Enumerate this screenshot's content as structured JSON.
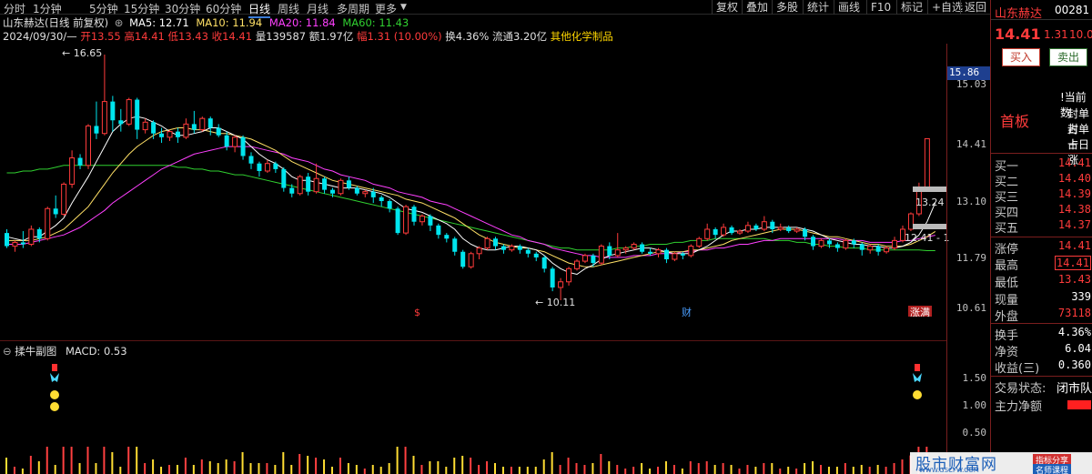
{
  "toolbar": {
    "timeframes": [
      "分时",
      "1分钟",
      "5分钟",
      "15分钟",
      "30分钟",
      "60分钟",
      "日线",
      "周线",
      "月线",
      "多周期",
      "更多"
    ],
    "active_timeframe": "日线",
    "right_buttons": [
      "复权",
      "叠加",
      "多股",
      "统计",
      "画线",
      "F10",
      "标记",
      "+自选",
      "返回"
    ]
  },
  "header": {
    "stock_title": "山东赫达(日线 前复权)",
    "ma5_label": "MA5: 12.71",
    "ma10_label": "MA10: 11.94",
    "ma20_label": "MA20: 11.84",
    "ma60_label": "MA60: 11.43",
    "date_line": "2024/09/30/—",
    "open": "开13.55",
    "high": "高14.41",
    "low": "低13.43",
    "close": "收14.41",
    "volume": "量139587",
    "amount": "额1.97亿",
    "change": "幅1.31 (10.00%)",
    "turnover": "换4.36%",
    "float_cap": "流通3.20亿",
    "industry": "其他化学制品"
  },
  "colors": {
    "up": "#ff3b3b",
    "down": "#00e5ee",
    "ma5": "#ffffff",
    "ma10": "#ffe066",
    "ma20": "#ff40ff",
    "ma60": "#30d030",
    "axis": "#7a1e1e",
    "label_yellow": "#ffd700"
  },
  "chart_data": {
    "type": "candlestick",
    "axis_labels": [
      "15.86",
      "15.03",
      "14.41",
      "13.10",
      "11.79",
      "10.61"
    ],
    "annotations": {
      "high_mark": "16.65",
      "low_mark": "10.11",
      "level_a": "13.24",
      "level_b": "12.41 - 1",
      "price_tag": "15.86",
      "tag_s": "$",
      "tag_cai": "财",
      "tag_zhangting": "涨满"
    },
    "candles": [
      [
        11.9,
        11.55,
        12.0,
        11.5
      ],
      [
        11.55,
        11.65,
        11.7,
        11.4
      ],
      [
        11.65,
        11.6,
        11.95,
        11.5
      ],
      [
        11.6,
        12.0,
        12.1,
        11.55
      ],
      [
        12.0,
        11.75,
        12.05,
        11.65
      ],
      [
        11.75,
        12.55,
        12.6,
        11.7
      ],
      [
        12.55,
        12.4,
        12.9,
        12.3
      ],
      [
        12.4,
        13.2,
        13.25,
        12.35
      ],
      [
        13.2,
        13.9,
        14.1,
        13.1
      ],
      [
        13.9,
        13.7,
        14.0,
        13.6
      ],
      [
        13.7,
        14.75,
        14.8,
        13.6
      ],
      [
        14.75,
        14.55,
        15.4,
        14.4
      ],
      [
        14.55,
        15.4,
        16.65,
        14.5
      ],
      [
        15.4,
        14.9,
        15.55,
        14.6
      ],
      [
        14.9,
        14.8,
        15.2,
        14.6
      ],
      [
        14.8,
        15.45,
        15.5,
        14.75
      ],
      [
        15.45,
        14.65,
        15.5,
        14.4
      ],
      [
        14.65,
        14.85,
        14.95,
        14.55
      ],
      [
        14.85,
        14.55,
        14.9,
        14.4
      ],
      [
        14.55,
        14.45,
        14.7,
        14.3
      ],
      [
        14.45,
        14.6,
        14.65,
        14.35
      ],
      [
        14.6,
        14.45,
        14.7,
        14.3
      ],
      [
        14.45,
        14.8,
        14.95,
        14.4
      ],
      [
        14.8,
        14.65,
        15.15,
        14.55
      ],
      [
        14.65,
        14.95,
        15.0,
        14.6
      ],
      [
        14.95,
        14.7,
        15.0,
        14.5
      ],
      [
        14.7,
        14.5,
        14.8,
        14.45
      ],
      [
        14.5,
        14.2,
        14.6,
        14.1
      ],
      [
        14.2,
        14.45,
        14.5,
        14.05
      ],
      [
        14.45,
        13.95,
        14.5,
        13.85
      ],
      [
        13.95,
        13.75,
        14.05,
        13.6
      ],
      [
        13.75,
        13.55,
        13.8,
        13.4
      ],
      [
        13.55,
        13.75,
        13.85,
        13.5
      ],
      [
        13.75,
        13.6,
        13.8,
        13.5
      ],
      [
        13.6,
        13.1,
        13.65,
        13.0
      ],
      [
        13.1,
        12.95,
        13.2,
        12.85
      ],
      [
        12.95,
        13.4,
        13.45,
        12.9
      ],
      [
        13.4,
        13.0,
        13.5,
        12.9
      ],
      [
        13.0,
        13.35,
        13.75,
        12.95
      ],
      [
        13.35,
        13.05,
        13.4,
        12.95
      ],
      [
        13.05,
        12.95,
        13.1,
        12.85
      ],
      [
        12.95,
        13.3,
        13.35,
        12.9
      ],
      [
        13.3,
        13.1,
        13.4,
        13.05
      ],
      [
        13.1,
        12.95,
        13.15,
        12.9
      ],
      [
        12.95,
        13.0,
        13.05,
        12.85
      ],
      [
        13.0,
        12.85,
        13.1,
        12.7
      ],
      [
        12.85,
        12.75,
        12.9,
        12.6
      ],
      [
        12.75,
        12.55,
        12.8,
        12.45
      ],
      [
        12.55,
        11.9,
        12.6,
        11.85
      ],
      [
        11.9,
        12.6,
        12.65,
        11.85
      ],
      [
        12.6,
        12.2,
        12.65,
        12.1
      ],
      [
        12.2,
        12.35,
        12.4,
        12.1
      ],
      [
        12.35,
        12.1,
        12.4,
        11.95
      ],
      [
        12.1,
        11.85,
        12.15,
        11.75
      ],
      [
        11.85,
        11.75,
        11.9,
        11.65
      ],
      [
        11.75,
        11.4,
        11.8,
        11.3
      ],
      [
        11.4,
        11.0,
        11.45,
        10.95
      ],
      [
        11.0,
        11.35,
        11.4,
        10.95
      ],
      [
        11.35,
        11.5,
        11.55,
        11.2
      ],
      [
        11.5,
        11.75,
        11.8,
        11.45
      ],
      [
        11.75,
        11.55,
        11.8,
        11.45
      ],
      [
        11.55,
        11.45,
        11.6,
        11.35
      ],
      [
        11.45,
        11.55,
        11.6,
        11.4
      ],
      [
        11.55,
        11.45,
        11.6,
        11.35
      ],
      [
        11.45,
        11.35,
        11.5,
        11.25
      ],
      [
        11.35,
        11.25,
        11.4,
        11.15
      ],
      [
        11.25,
        10.95,
        11.3,
        10.85
      ],
      [
        10.95,
        10.45,
        11.0,
        10.35
      ],
      [
        10.45,
        10.6,
        10.7,
        10.11
      ],
      [
        10.6,
        10.95,
        11.0,
        10.5
      ],
      [
        10.95,
        11.15,
        11.2,
        10.9
      ],
      [
        11.15,
        11.3,
        11.35,
        11.1
      ],
      [
        11.3,
        11.1,
        11.35,
        11.0
      ],
      [
        11.1,
        11.55,
        11.6,
        11.05
      ],
      [
        11.55,
        11.3,
        11.65,
        11.2
      ],
      [
        11.3,
        11.45,
        11.9,
        11.25
      ],
      [
        11.45,
        11.5,
        11.55,
        11.35
      ],
      [
        11.5,
        11.6,
        11.65,
        11.45
      ],
      [
        11.6,
        11.4,
        11.65,
        11.35
      ],
      [
        11.4,
        11.35,
        11.5,
        11.3
      ],
      [
        11.35,
        11.45,
        11.5,
        11.25
      ],
      [
        11.45,
        11.2,
        11.5,
        11.1
      ],
      [
        11.2,
        11.35,
        11.4,
        11.15
      ],
      [
        11.35,
        11.3,
        11.4,
        11.2
      ],
      [
        11.3,
        11.55,
        11.6,
        11.25
      ],
      [
        11.55,
        11.75,
        11.8,
        11.5
      ],
      [
        11.75,
        12.0,
        12.15,
        11.7
      ],
      [
        12.0,
        11.85,
        12.05,
        11.75
      ],
      [
        11.85,
        12.05,
        12.15,
        11.8
      ],
      [
        12.05,
        11.9,
        12.1,
        11.85
      ],
      [
        11.9,
        11.95,
        12.0,
        11.85
      ],
      [
        11.95,
        12.1,
        12.2,
        11.9
      ],
      [
        12.1,
        12.0,
        12.15,
        11.95
      ],
      [
        12.0,
        12.2,
        12.35,
        11.95
      ],
      [
        12.2,
        12.0,
        12.25,
        11.9
      ],
      [
        12.0,
        12.05,
        12.15,
        11.95
      ],
      [
        12.05,
        11.95,
        12.1,
        11.9
      ],
      [
        11.95,
        12.0,
        12.05,
        11.9
      ],
      [
        12.0,
        11.8,
        12.05,
        11.7
      ],
      [
        11.8,
        11.55,
        11.85,
        11.45
      ],
      [
        11.55,
        11.7,
        11.75,
        11.5
      ],
      [
        11.7,
        11.6,
        11.75,
        11.5
      ],
      [
        11.6,
        11.5,
        11.65,
        11.4
      ],
      [
        11.5,
        11.7,
        11.75,
        11.45
      ],
      [
        11.7,
        11.6,
        11.75,
        11.5
      ],
      [
        11.6,
        11.45,
        11.65,
        11.3
      ],
      [
        11.45,
        11.55,
        11.6,
        11.35
      ],
      [
        11.55,
        11.4,
        11.6,
        11.3
      ],
      [
        11.4,
        11.5,
        11.55,
        11.35
      ],
      [
        11.5,
        11.7,
        11.8,
        11.45
      ],
      [
        11.7,
        12.0,
        12.1,
        11.65
      ],
      [
        12.0,
        12.41,
        12.45,
        11.95
      ],
      [
        12.41,
        13.1,
        13.24,
        12.35
      ],
      [
        13.1,
        14.41,
        14.41,
        13.43
      ]
    ],
    "ma_lines": {
      "ma5": [
        11.8,
        11.75,
        11.7,
        11.8,
        11.8,
        11.95,
        12.1,
        12.3,
        12.7,
        13.05,
        13.4,
        13.8,
        14.2,
        14.6,
        14.8,
        14.95,
        15.0,
        14.95,
        14.85,
        14.75,
        14.6,
        14.5,
        14.5,
        14.55,
        14.6,
        14.7,
        14.7,
        14.6,
        14.5,
        14.4,
        14.2,
        14.0,
        13.85,
        13.75,
        13.6,
        13.4,
        13.3,
        13.3,
        13.25,
        13.2,
        13.15,
        13.1,
        13.1,
        13.1,
        13.05,
        13.0,
        12.95,
        12.85,
        12.7,
        12.55,
        12.5,
        12.45,
        12.35,
        12.25,
        12.15,
        12.0,
        11.75,
        11.6,
        11.5,
        11.45,
        11.45,
        11.5,
        11.55,
        11.55,
        11.5,
        11.45,
        11.3,
        11.1,
        10.95,
        10.85,
        10.8,
        10.95,
        11.05,
        11.2,
        11.3,
        11.35,
        11.4,
        11.45,
        11.5,
        11.5,
        11.45,
        11.4,
        11.35,
        11.35,
        11.35,
        11.45,
        11.55,
        11.7,
        11.85,
        11.95,
        11.95,
        12.0,
        12.0,
        12.05,
        12.05,
        12.05,
        12.05,
        12.05,
        12.0,
        11.95,
        11.85,
        11.75,
        11.7,
        11.65,
        11.6,
        11.6,
        11.55,
        11.55,
        11.5,
        11.5,
        11.55,
        11.65,
        11.85,
        12.2,
        12.71
      ],
      "ma10": [
        11.7,
        11.7,
        11.7,
        11.7,
        11.75,
        11.8,
        11.9,
        12.0,
        12.2,
        12.4,
        12.6,
        12.9,
        13.2,
        13.5,
        13.75,
        14.0,
        14.2,
        14.35,
        14.5,
        14.6,
        14.65,
        14.7,
        14.7,
        14.65,
        14.65,
        14.6,
        14.55,
        14.55,
        14.5,
        14.45,
        14.4,
        14.3,
        14.2,
        14.1,
        13.95,
        13.8,
        13.7,
        13.6,
        13.5,
        13.4,
        13.3,
        13.25,
        13.2,
        13.15,
        13.1,
        13.05,
        13.0,
        12.95,
        12.9,
        12.8,
        12.75,
        12.7,
        12.6,
        12.5,
        12.4,
        12.3,
        12.15,
        12.0,
        11.85,
        11.75,
        11.65,
        11.6,
        11.55,
        11.5,
        11.5,
        11.45,
        11.4,
        11.3,
        11.2,
        11.1,
        11.05,
        11.0,
        11.0,
        11.05,
        11.1,
        11.15,
        11.2,
        11.25,
        11.3,
        11.35,
        11.4,
        11.4,
        11.4,
        11.4,
        11.45,
        11.45,
        11.5,
        11.55,
        11.6,
        11.7,
        11.75,
        11.8,
        11.85,
        11.9,
        11.95,
        12.0,
        12.0,
        12.0,
        11.95,
        11.9,
        11.85,
        11.8,
        11.8,
        11.75,
        11.7,
        11.65,
        11.6,
        11.6,
        11.55,
        11.55,
        11.55,
        11.6,
        11.7,
        11.8,
        11.94
      ],
      "ma20": [
        11.6,
        11.6,
        11.6,
        11.65,
        11.7,
        11.75,
        11.8,
        11.85,
        11.95,
        12.05,
        12.2,
        12.35,
        12.5,
        12.7,
        12.85,
        13.0,
        13.15,
        13.3,
        13.45,
        13.6,
        13.7,
        13.8,
        13.9,
        14.0,
        14.05,
        14.1,
        14.15,
        14.2,
        14.2,
        14.2,
        14.2,
        14.15,
        14.1,
        14.05,
        14.0,
        13.9,
        13.85,
        13.8,
        13.7,
        13.6,
        13.55,
        13.45,
        13.4,
        13.35,
        13.3,
        13.2,
        13.15,
        13.1,
        13.0,
        12.95,
        12.9,
        12.85,
        12.75,
        12.7,
        12.65,
        12.55,
        12.45,
        12.35,
        12.25,
        12.15,
        12.05,
        11.95,
        11.85,
        11.8,
        11.7,
        11.65,
        11.6,
        11.5,
        11.45,
        11.4,
        11.35,
        11.3,
        11.3,
        11.25,
        11.25,
        11.25,
        11.25,
        11.3,
        11.3,
        11.3,
        11.35,
        11.35,
        11.35,
        11.4,
        11.4,
        11.45,
        11.45,
        11.5,
        11.5,
        11.55,
        11.6,
        11.6,
        11.65,
        11.7,
        11.7,
        11.75,
        11.75,
        11.75,
        11.75,
        11.75,
        11.75,
        11.75,
        11.75,
        11.7,
        11.7,
        11.7,
        11.65,
        11.65,
        11.65,
        11.65,
        11.7,
        11.7,
        11.75,
        11.8,
        11.84
      ],
      "ma60": [
        13.5,
        13.5,
        13.55,
        13.55,
        13.6,
        13.6,
        13.65,
        13.7,
        13.7,
        13.7,
        13.7,
        13.7,
        13.7,
        13.7,
        13.7,
        13.7,
        13.7,
        13.7,
        13.7,
        13.7,
        13.7,
        13.65,
        13.65,
        13.6,
        13.6,
        13.55,
        13.55,
        13.5,
        13.45,
        13.45,
        13.4,
        13.35,
        13.3,
        13.25,
        13.2,
        13.15,
        13.1,
        13.05,
        13.0,
        12.95,
        12.9,
        12.85,
        12.8,
        12.75,
        12.7,
        12.65,
        12.6,
        12.55,
        12.5,
        12.45,
        12.4,
        12.35,
        12.3,
        12.25,
        12.2,
        12.15,
        12.1,
        12.05,
        12.0,
        11.95,
        11.9,
        11.85,
        11.8,
        11.75,
        11.7,
        11.65,
        11.6,
        11.55,
        11.5,
        11.5,
        11.45,
        11.45,
        11.45,
        11.45,
        11.45,
        11.5,
        11.5,
        11.55,
        11.55,
        11.6,
        11.6,
        11.6,
        11.65,
        11.65,
        11.7,
        11.7,
        11.7,
        11.75,
        11.75,
        11.75,
        11.75,
        11.75,
        11.75,
        11.75,
        11.7,
        11.7,
        11.7,
        11.65,
        11.65,
        11.6,
        11.6,
        11.55,
        11.55,
        11.5,
        11.5,
        11.5,
        11.45,
        11.45,
        11.45,
        11.45,
        11.45,
        11.45,
        11.45,
        11.43,
        11.43
      ]
    }
  },
  "sub_panel": {
    "title": "揉牛副图",
    "macd_label": "MACD: 0.53",
    "axis_labels": [
      "1.50",
      "1.00",
      "0.50"
    ]
  },
  "right_panel": {
    "stock_name": "山东赫达",
    "stock_code": "00281",
    "price": "14.41",
    "change": "1.31",
    "pct": "10.0",
    "buy_btn": "买入",
    "sell_btn": "卖出",
    "first_board": "首板",
    "notes": [
      "!当前数",
      "封单占",
      "封单占",
      "十日涨"
    ],
    "quotes": [
      {
        "label": "买一",
        "value": "14.41"
      },
      {
        "label": "买二",
        "value": "14.40"
      },
      {
        "label": "买三",
        "value": "14.39"
      },
      {
        "label": "买四",
        "value": "14.38"
      },
      {
        "label": "买五",
        "value": "14.37"
      }
    ],
    "stats": [
      {
        "label": "涨停",
        "value": "14.41"
      },
      {
        "label": "最高",
        "value": "14.41"
      },
      {
        "label": "最低",
        "value": "13.43"
      },
      {
        "label": "现量",
        "value": "339"
      },
      {
        "label": "外盘",
        "value": "73118"
      }
    ],
    "stats2": [
      {
        "label": "换手",
        "value": "4.36%"
      },
      {
        "label": "净资",
        "value": "6.04"
      },
      {
        "label": "收益(三)",
        "value": "0.360"
      }
    ],
    "trade_state_label": "交易状态:",
    "trade_state_value": "闭市队",
    "main_force_label": "主力净额"
  },
  "watermark": {
    "brand": "股市财富网",
    "url": "WWW.GSCFW.COM",
    "tag1": "指标分享",
    "tag2": "名师课程"
  }
}
